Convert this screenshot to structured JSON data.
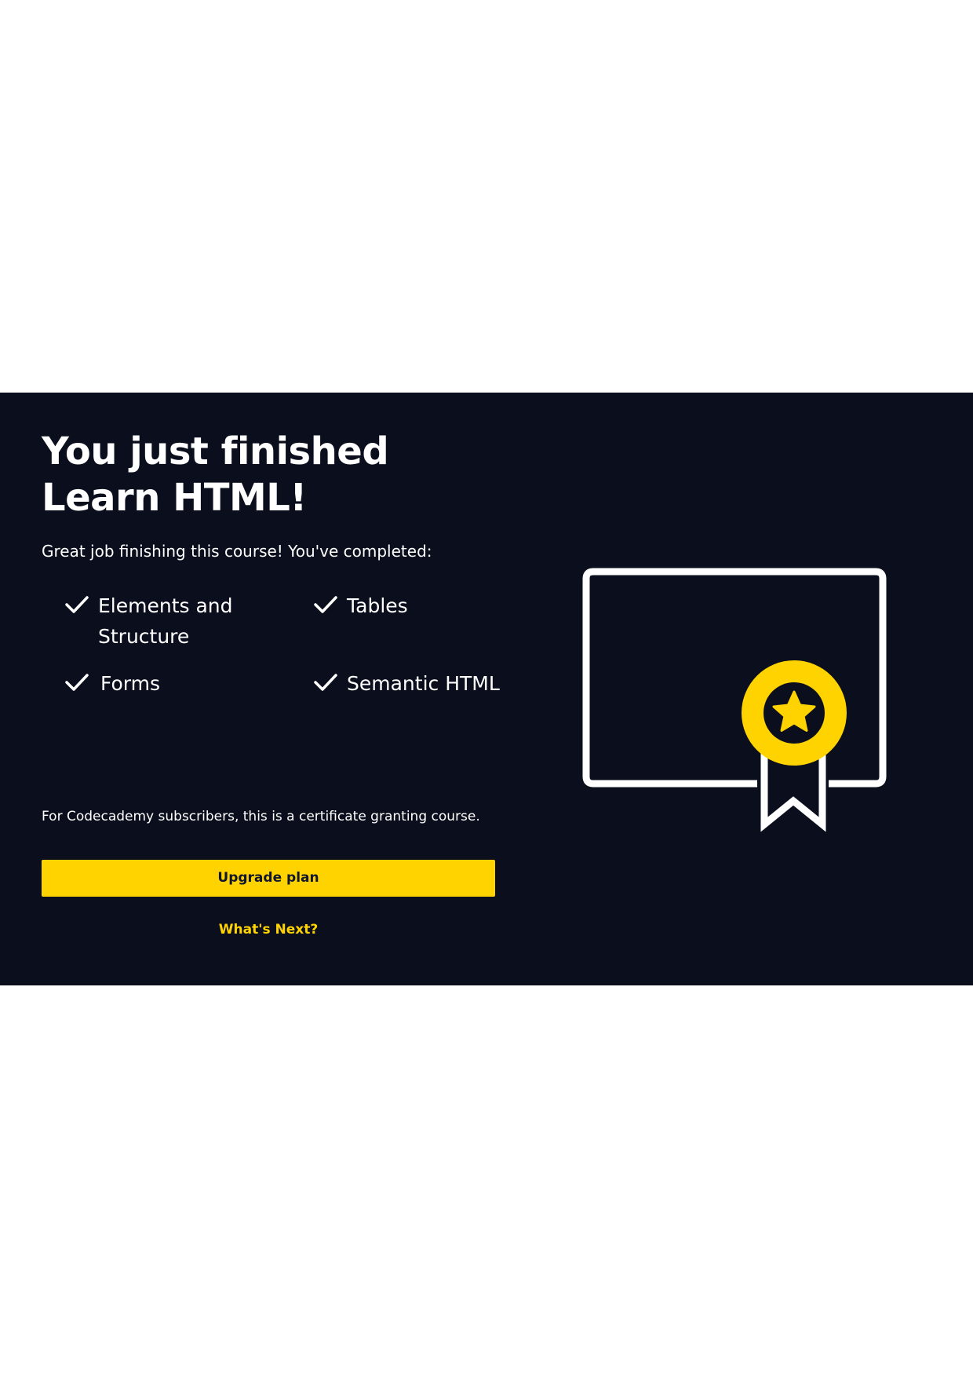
{
  "completion": {
    "title_line1": "You just finished",
    "title_line2": "Learn HTML!",
    "subtitle": "Great job finishing this course! You've completed:",
    "topics": [
      {
        "label": "Elements and Structure",
        "icon": "checkmark-icon"
      },
      {
        "label": "Tables",
        "icon": "checkmark-icon"
      },
      {
        "label": "Forms",
        "icon": "checkmark-icon"
      },
      {
        "label": "Semantic HTML",
        "icon": "checkmark-icon"
      }
    ],
    "certificate_note": "For Codecademy subscribers, this is a certificate granting course.",
    "upgrade_label": "Upgrade plan",
    "whats_next_label": "What's Next?",
    "illustration": "certificate-ribbon-icon"
  },
  "colors": {
    "panel_background": "#0b0f1d",
    "accent_yellow": "#ffd300",
    "text": "#ffffff",
    "page_background": "#ffffff"
  }
}
